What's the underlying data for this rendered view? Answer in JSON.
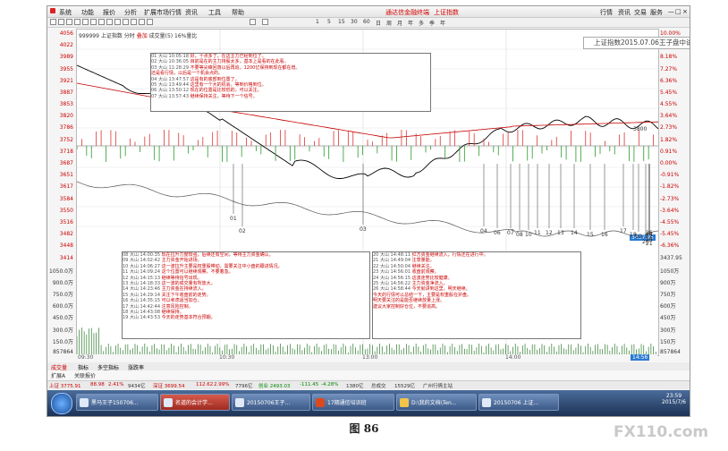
{
  "menu": {
    "items": [
      "系统",
      "功能",
      "报价",
      "分析",
      "扩展市场行情",
      "资讯",
      "工具",
      "帮助"
    ],
    "center_title": "通达信金融终端",
    "center_sub": "上证指数",
    "right_items": [
      "行情",
      "资讯",
      "交易",
      "服务"
    ],
    "window_buttons": [
      "—",
      "□",
      "×"
    ]
  },
  "toolbar": {
    "periods": [
      "1",
      "5",
      "15",
      "30",
      "60",
      "日",
      "周",
      "月",
      "年",
      "多",
      "季",
      "年"
    ]
  },
  "chart_header": {
    "code": "999999",
    "name": "上证指数",
    "period": "分时",
    "tag": "叠加",
    "values": "成交量(5) 16%量比"
  },
  "annotation_title": "上证指数2015.07.06王子盘中讲解",
  "y_left": [
    "4056",
    "4022",
    "3989",
    "3955",
    "3921",
    "3887",
    "3853",
    "3820",
    "3786",
    "3752",
    "3718",
    "3687",
    "3651",
    "3617",
    "3584",
    "3550",
    "3516",
    "3482",
    "3448",
    "3414",
    "1050.0万",
    "900.0万",
    "750.0万",
    "600.0万",
    "450.0万",
    "300.0万",
    "150.0万",
    "857864"
  ],
  "y_right": [
    "10.00%",
    "9.18%",
    "8.18%",
    "7.27%",
    "6.36%",
    "5.45%",
    "4.55%",
    "3.64%",
    "2.73%",
    "1.82%",
    "0.91%",
    "0.00%",
    "-0.91%",
    "-1.82%",
    "-2.73%",
    "-3.64%",
    "-4.55%",
    "-5.45%",
    "-6.36%",
    "3437.95",
    "1050万",
    "900万",
    "750万",
    "600万",
    "450万",
    "300万",
    "150万",
    "857864"
  ],
  "price_marks": {
    "p3800": "3800",
    "right_box": "3437.95",
    "cursor": "14:56"
  },
  "point_labels": [
    "01",
    "02",
    "03",
    "04",
    "06",
    "07",
    "08",
    "10",
    "11",
    "12",
    "13",
    "14",
    "15",
    "16",
    "17",
    "18",
    "19",
    "20",
    "21",
    "22",
    "23",
    "24",
    "25",
    "26"
  ],
  "time_axis": [
    "09:30",
    "10:30",
    "13:00",
    "14:00",
    "15:00"
  ],
  "notes_top": [
    [
      "01",
      "大山",
      "10:05:18",
      "好，十点多了，在这主力已经到位了。"
    ],
    [
      "02",
      "大山",
      "10:36:05",
      "目前是在的主力持股太多，基本上是看的在此看。"
    ],
    [
      "03",
      "大山",
      "11:28:29",
      "不要等尖峰回落以后再追，1200亿保持到现在都在增。"
    ],
    [
      "",
      "",
      "",
      "还是看行情，以后是一个机会点的。"
    ],
    [
      "04",
      "大山",
      "13:47:57",
      "这是有的底部到位置了。"
    ],
    [
      "05",
      "大山",
      "13:49:44",
      "这里有一个大的机会，等到价格到位。"
    ],
    [
      "06",
      "大山",
      "13:50:12",
      "现在的位置是比较低的，可以关注。"
    ],
    [
      "07",
      "大山",
      "13:57:43",
      "继续保持关注，等待下一个信号。"
    ]
  ],
  "notes_bottom_left": [
    [
      "08",
      "大山",
      "14:00:35",
      "现在拉升力度较强，后续还有空间，等待主力资金确认。"
    ],
    [
      "09",
      "大山",
      "14:02:42",
      "主力资金开始进场。"
    ],
    [
      "10",
      "大山",
      "14:06:27",
      "这一波拉升主要是权重股带动，需要关注中小盘的跟进情况。"
    ],
    [
      "11",
      "大山",
      "14:09:24",
      "这个位置可以继续观察，不要着急。"
    ],
    [
      "12",
      "大山",
      "14:15:13",
      "继续等待信号出现。"
    ],
    [
      "13",
      "大山",
      "14:18:33",
      "这一波的成交量有所放大。"
    ],
    [
      "14",
      "大山",
      "14:23:46",
      "主力资金在持续流入。"
    ],
    [
      "15",
      "大山",
      "14:29:14",
      "关注下午收盘前的走势。"
    ],
    [
      "16",
      "大山",
      "14:35:15",
      "可以考虑适当加仓。"
    ],
    [
      "17",
      "大山",
      "14:42:44",
      "注意风险控制。"
    ],
    [
      "18",
      "大山",
      "14:43:08",
      "继续保持。"
    ],
    [
      "19",
      "大山",
      "14:43:53",
      "今天的走势基本符合预期。"
    ]
  ],
  "notes_bottom_right": [
    [
      "20",
      "大山",
      "14:48:11",
      "红方资金继续流入，行情还在进行中。"
    ],
    [
      "21",
      "大山",
      "14:49:04",
      "注意量能。"
    ],
    [
      "22",
      "大山",
      "14:50:04",
      "继续关注。"
    ],
    [
      "23",
      "大山",
      "14:56:01",
      "收盘前观察。"
    ],
    [
      "24",
      "大山",
      "14:56:15",
      "这波走势比较健康。"
    ],
    [
      "25",
      "大山",
      "14:56:22",
      "主力资金净流入。"
    ],
    [
      "26",
      "大山",
      "14:58:44",
      "今天就讲到这里，明天继续。"
    ],
    [
      "",
      "",
      "",
      "今天的行情可以总结一下，主要是权重股在护盘。"
    ],
    [
      "",
      "",
      "",
      "明天要关注的是能否继续放量上涨。"
    ],
    [
      "",
      "",
      "",
      "建议大家控制好仓位，不要追高。"
    ]
  ],
  "tabs": [
    "成交量",
    "指标",
    "多空指标",
    "涨跌率"
  ],
  "tabs2": [
    "扩展A",
    "关联报价"
  ],
  "status": {
    "sh": "上证 3775.91",
    "sh_chg": "88.98",
    "sh_pct": "2.41%",
    "sh_amt": "9434亿",
    "sz": "深证 3699.54",
    "sz_chg": "112.62",
    "sz_pct": "2.99%",
    "sz_amt": "7796亿",
    "cy": "创业 2493.03",
    "cy_chg": "-111.45",
    "cy_pct": "-4.28%",
    "cy_amt": "1380亿",
    "extra1": "总成交",
    "extra2": "15529亿",
    "extra3": "广州行情主站"
  },
  "taskbar": [
    {
      "label": "黑马王子150706..."
    },
    {
      "label": "名道的会计学..."
    },
    {
      "label": "20150706王子..."
    },
    {
      "label": "17期通信培训班"
    },
    {
      "label": "D:\\我的文档\\Ten..."
    },
    {
      "label": "20150706 上证..."
    }
  ],
  "tray": {
    "time": "23:59",
    "date": "2015/7/6"
  },
  "caption": "图  86",
  "watermark": "FX110.com",
  "colors": {
    "price": "#000000",
    "avg": "#c40000",
    "volume": "#2a7a2a",
    "annot": "#c00000"
  }
}
